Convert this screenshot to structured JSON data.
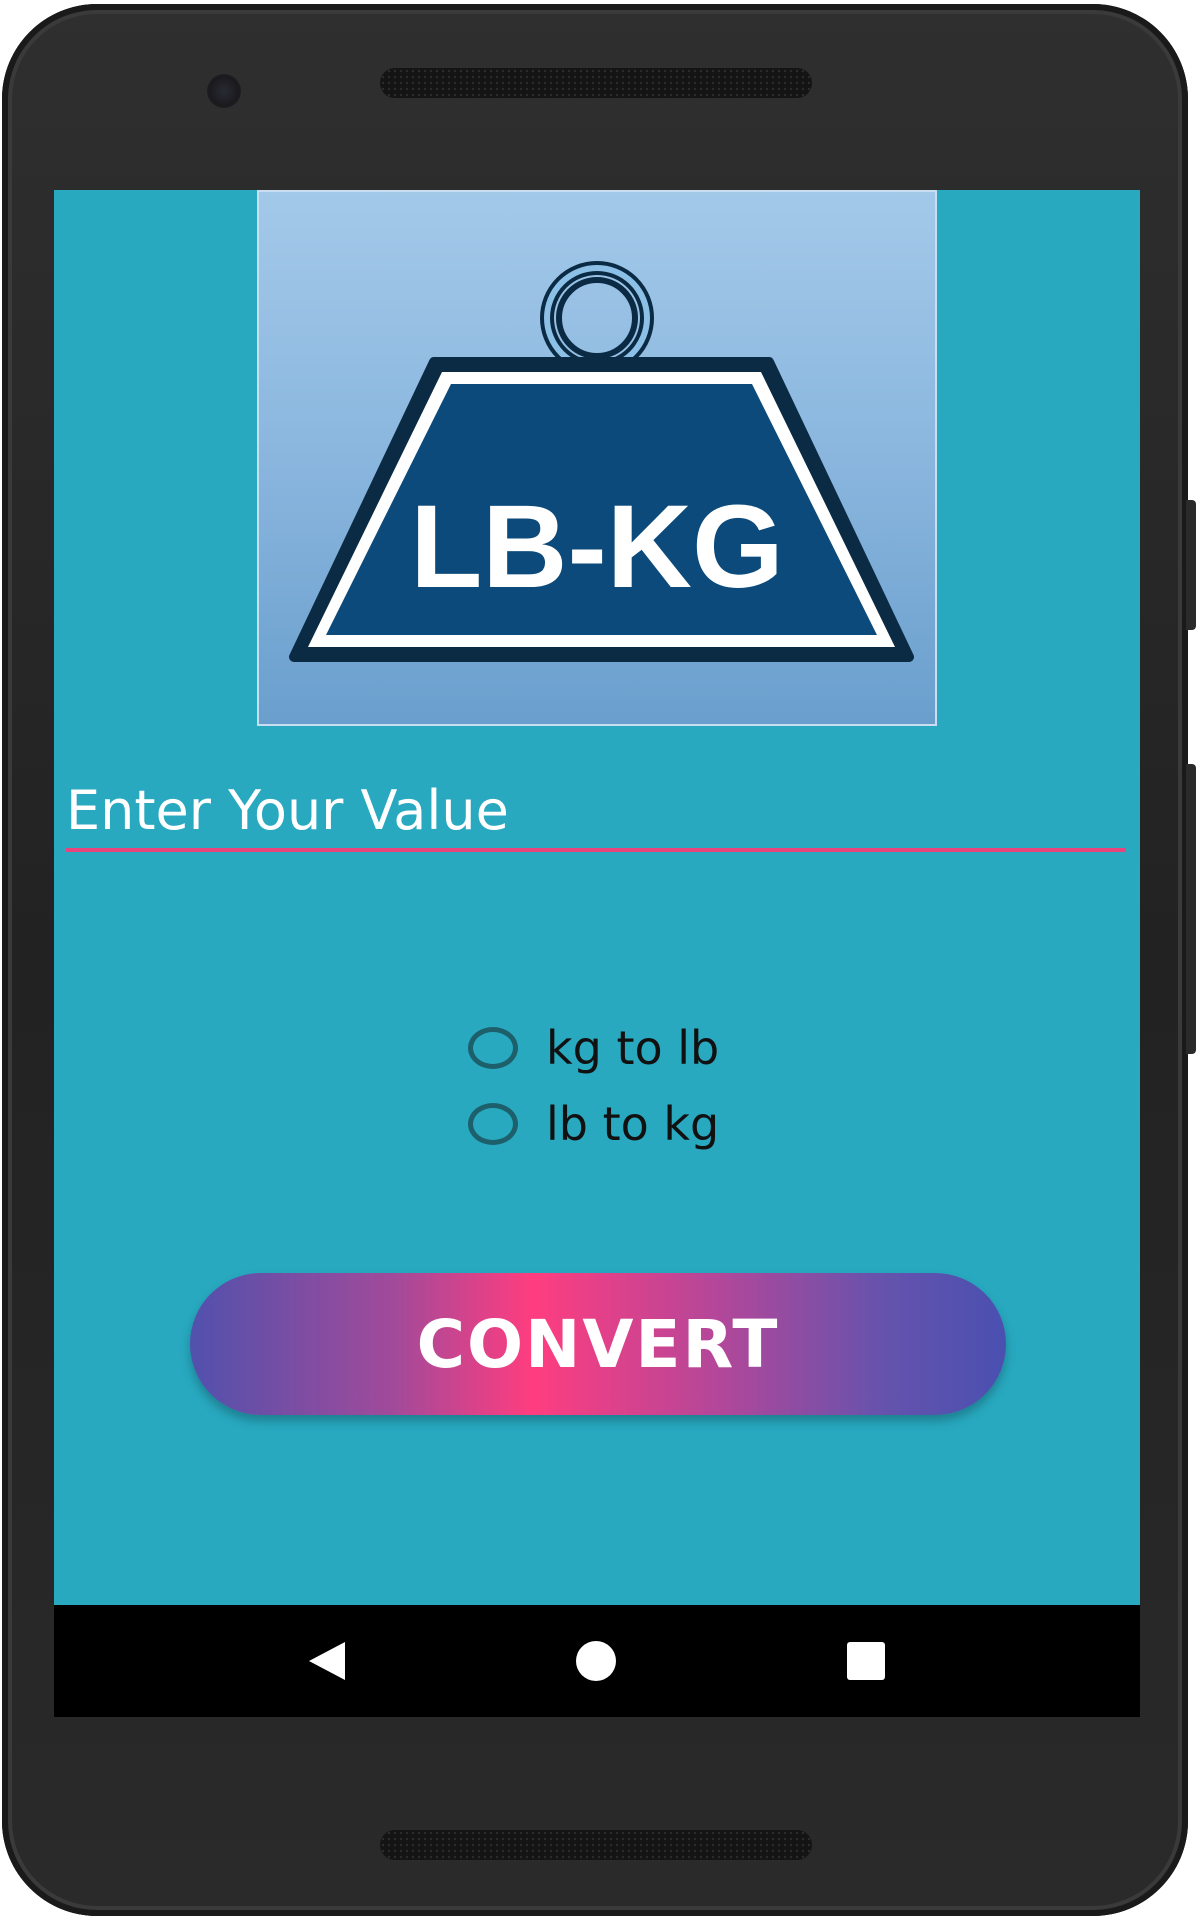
{
  "logo": {
    "text": "LB-KG"
  },
  "value_input": {
    "placeholder": "Enter Your Value",
    "value": ""
  },
  "radio_options": [
    {
      "label": "kg to lb",
      "selected": false
    },
    {
      "label": "lb to kg",
      "selected": false
    }
  ],
  "convert_button": {
    "label": "CONVERT"
  },
  "navigation": {
    "back_icon": "back-triangle-icon",
    "home_icon": "home-circle-icon",
    "recents_icon": "recents-square-icon"
  },
  "colors": {
    "screen_background": "#28a9c0",
    "input_underline": "#e8457d",
    "button_gradient_center": "#ff3d7f",
    "button_gradient_edge": "#5151ad",
    "weight_fill": "#0b4a7a"
  }
}
